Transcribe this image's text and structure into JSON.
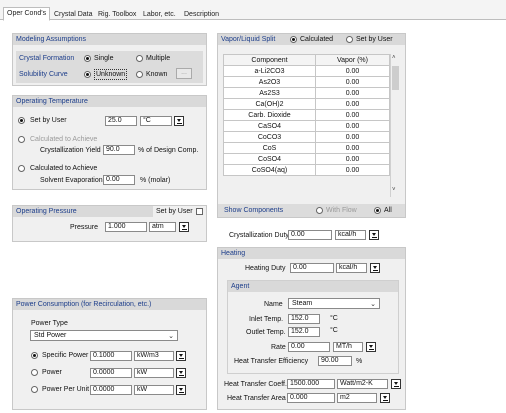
{
  "tabs": [
    "Oper Cond's",
    "Crystal Data",
    "Rig. Toolbox",
    "Labor, etc.",
    "Description"
  ],
  "modeling": {
    "title": "Modeling Assumptions",
    "crystal_formation_label": "Crystal Formation",
    "single": "Single",
    "multiple": "Multiple",
    "solubility_curve_label": "Solubility Curve",
    "unknown": "Unknown",
    "known": "Known",
    "ellipsis": "..."
  },
  "temperature": {
    "title": "Operating Temperature",
    "set_by_user": "Set by User",
    "temp_value": "25.0",
    "temp_unit": "°C",
    "calc_to_achieve_1": "Calculated to Achieve",
    "cryst_yield_label": "Crystallization Yield",
    "cryst_yield_value": "90.0",
    "cryst_yield_suffix": "% of Design Comp.",
    "calc_to_achieve_2": "Calculated to Achieve",
    "solvent_evap_label": "Solvent Evaporation",
    "solvent_evap_value": "0.00",
    "solvent_evap_unit": "% (molar)"
  },
  "pressure": {
    "title": "Operating Pressure",
    "set_by_user": "Set by User",
    "label": "Pressure",
    "value": "1.000",
    "unit": "atm"
  },
  "power": {
    "title": "Power Consumption (for Recirculation, etc.)",
    "type_label": "Power Type",
    "type_value": "Std Power",
    "specific_power_label": "Specific Power",
    "specific_power_value": "0.1000",
    "specific_power_unit": "kW/m3",
    "power_label": "Power",
    "power_value": "0.0000",
    "power_unit": "kW",
    "power_per_unit_label": "Power Per Unit",
    "power_per_unit_value": "0.0000",
    "power_per_unit_unit": "kW"
  },
  "vapor": {
    "title": "Vapor/Liquid Split",
    "calculated": "Calculated",
    "set_by_user": "Set by User",
    "col_component": "Component",
    "col_vapor": "Vapor (%)",
    "rows": [
      {
        "component": "a-Li2CO3",
        "vapor": "0.00"
      },
      {
        "component": "As2O3",
        "vapor": "0.00"
      },
      {
        "component": "As2S3",
        "vapor": "0.00"
      },
      {
        "component": "Ca(OH)2",
        "vapor": "0.00"
      },
      {
        "component": "Carb. Dioxide",
        "vapor": "0.00"
      },
      {
        "component": "CaSO4",
        "vapor": "0.00"
      },
      {
        "component": "CoCO3",
        "vapor": "0.00"
      },
      {
        "component": "CoS",
        "vapor": "0.00"
      },
      {
        "component": "CoSO4",
        "vapor": "0.00"
      },
      {
        "component": "CoSO4(aq)",
        "vapor": "0.00"
      }
    ],
    "show_components": "Show Components",
    "with_flow": "With Flow",
    "all": "All"
  },
  "cryst_duty": {
    "label": "Crystallization Duty",
    "value": "0.00",
    "unit": "kcal/h"
  },
  "heating": {
    "title": "Heating",
    "duty_label": "Heating Duty",
    "duty_value": "0.00",
    "duty_unit": "kcal/h",
    "agent_title": "Agent",
    "name_label": "Name",
    "name_value": "Steam",
    "inlet_label": "Inlet Temp.",
    "inlet_value": "152.0",
    "inlet_unit": "°C",
    "outlet_label": "Outlet Temp.",
    "outlet_value": "152.0",
    "outlet_unit": "°C",
    "rate_label": "Rate",
    "rate_value": "0.00",
    "rate_unit": "MT/h",
    "eff_label": "Heat Transfer Efficiency",
    "eff_value": "90.00",
    "eff_unit": "%",
    "coeff_label": "Heat Transfer Coeff.",
    "coeff_value": "1500.000",
    "coeff_unit": "Watt/m2-K",
    "area_label": "Heat Transfer Area",
    "area_value": "0.000",
    "area_unit": "m2"
  }
}
